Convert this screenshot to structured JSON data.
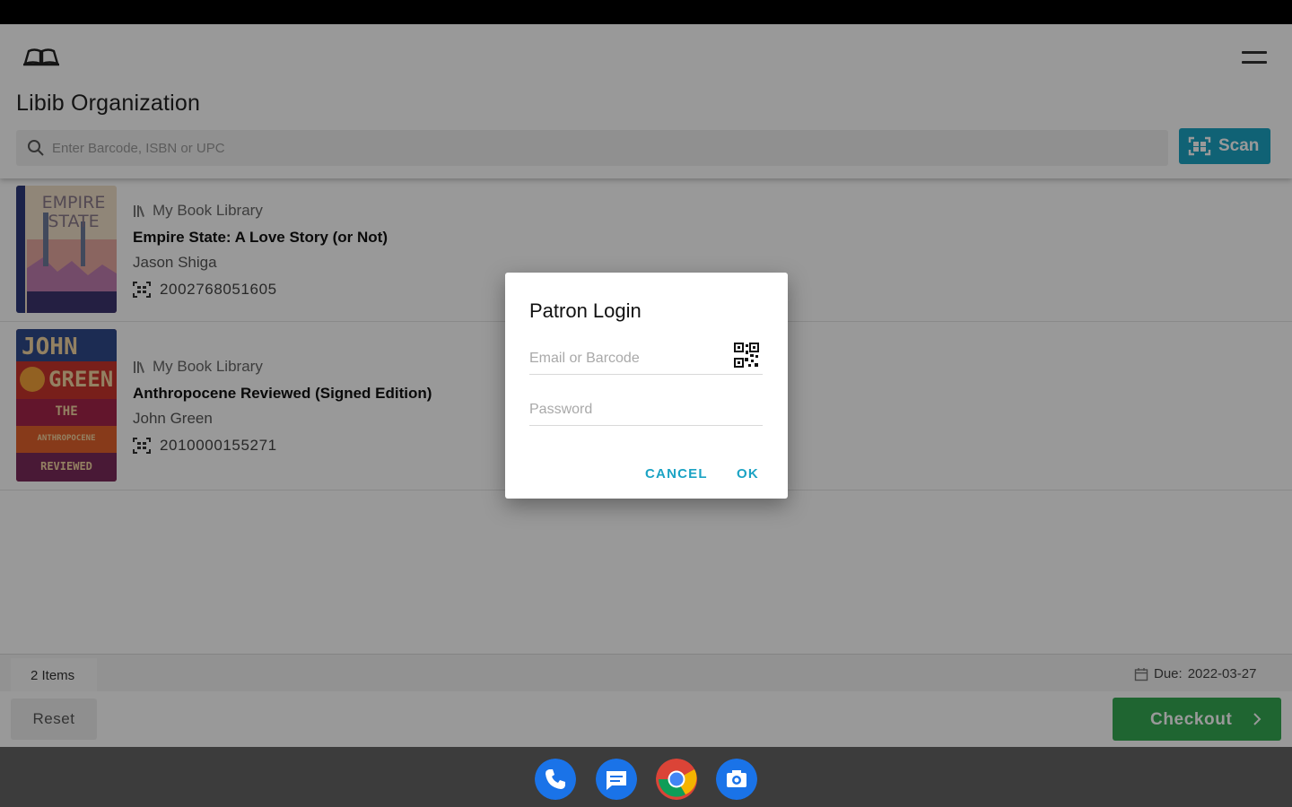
{
  "app": {
    "org_name": "Libib Organization",
    "search_placeholder": "Enter Barcode, ISBN or UPC",
    "scan_label": "Scan"
  },
  "books": [
    {
      "library": "My Book Library",
      "title": "Empire State: A Love Story (or Not)",
      "author": "Jason Shiga",
      "barcode": "2002768051605",
      "cover_text": [
        "EMPIRE",
        "STATE"
      ]
    },
    {
      "library": "My Book Library",
      "title": "Anthropocene Reviewed (Signed Edition)",
      "author": "John Green",
      "barcode": "2010000155271",
      "cover_text": [
        "JOHN",
        "GREEN",
        "THE",
        "ANTHROPOCENE",
        "REVIEWED"
      ]
    }
  ],
  "summary": {
    "items_count": "2 Items",
    "due_label": "Due:",
    "due_date": "2022-03-27"
  },
  "footer": {
    "reset_label": "Reset",
    "checkout_label": "Checkout"
  },
  "dialog": {
    "title": "Patron Login",
    "email_placeholder": "Email or Barcode",
    "password_placeholder": "Password",
    "cancel_label": "CANCEL",
    "ok_label": "OK"
  },
  "dock": [
    "phone-icon",
    "messages-icon",
    "chrome-icon",
    "camera-icon"
  ],
  "colors": {
    "accent": "#1ba3c4",
    "checkout": "#34a853",
    "navbar": "#3c3c3c"
  }
}
